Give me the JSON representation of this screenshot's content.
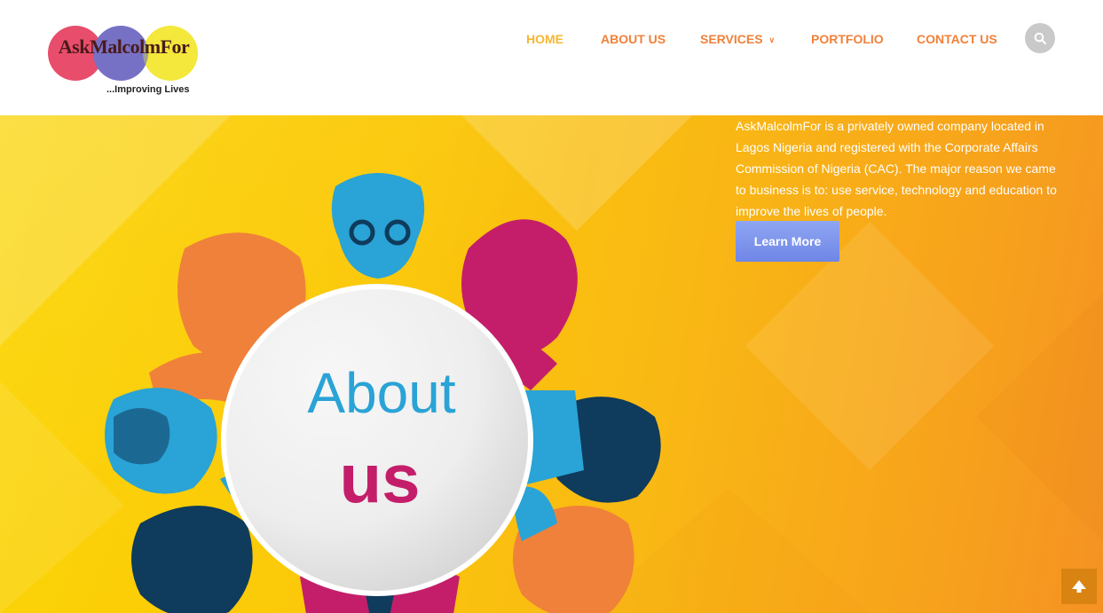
{
  "logo": {
    "name": "AskMalcolmFor",
    "tagline": "...Improving Lives"
  },
  "nav": {
    "items": [
      {
        "label": "HOME",
        "active": true
      },
      {
        "label": "ABOUT US",
        "active": false
      },
      {
        "label": "SERVICES",
        "active": false,
        "has_dropdown": true
      },
      {
        "label": "PORTFOLIO",
        "active": false
      },
      {
        "label": "CONTACT US",
        "active": false
      }
    ],
    "search_icon": "search-icon"
  },
  "hero": {
    "graphic_word1": "About",
    "graphic_word2": "us",
    "description": "AskMalcolmFor is a privately owned company located in Lagos Nigeria and registered with the Corporate Affairs Commission of Nigeria (CAC). The major reason we came to business is to: use service, technology and education to improve the lives of people.",
    "button_label": "Learn More"
  },
  "scroll_top_icon": "arrow-up-icon",
  "colors": {
    "nav_text": "#f0813a",
    "nav_active": "#f7b733",
    "hero_gradient_start": "#fbd400",
    "hero_gradient_end": "#f59223",
    "button": "#7b91ea",
    "about_blue": "#2aa3d6",
    "about_magenta": "#c41e6a",
    "scroll_top": "#d98312"
  }
}
